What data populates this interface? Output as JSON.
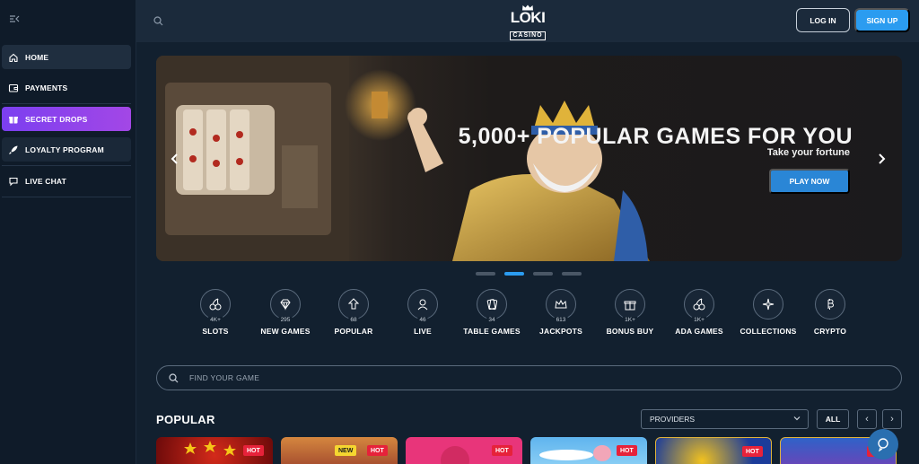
{
  "sidebar": {
    "items": [
      {
        "label": "HOME",
        "icon": "home-icon"
      },
      {
        "label": "PAYMENTS",
        "icon": "wallet-icon"
      },
      {
        "label": "SECRET DROPS",
        "icon": "gift-box-icon"
      },
      {
        "label": "LOYALTY PROGRAM",
        "icon": "rocket-icon"
      },
      {
        "label": "LIVE CHAT",
        "icon": "chat-bubble-icon"
      }
    ]
  },
  "header": {
    "logo_word": "LOKI",
    "logo_sub": "CASINO",
    "login_label": "LOG IN",
    "signup_label": "SIGN UP"
  },
  "hero": {
    "title": "5,000+ POPULAR GAMES FOR YOU",
    "subtitle": "Take your fortune",
    "cta_label": "PLAY NOW",
    "slide_count": 4,
    "active_slide": 2
  },
  "categories": [
    {
      "label": "SLOTS",
      "count": "4K+",
      "icon": "cherries-icon"
    },
    {
      "label": "NEW GAMES",
      "count": "295",
      "icon": "diamond-icon"
    },
    {
      "label": "POPULAR",
      "count": "68",
      "icon": "top-arrow-icon"
    },
    {
      "label": "LIVE",
      "count": "46",
      "icon": "dealer-icon"
    },
    {
      "label": "TABLE GAMES",
      "count": "34",
      "icon": "cards-icon"
    },
    {
      "label": "JACKPOTS",
      "count": "613",
      "icon": "crown-icon"
    },
    {
      "label": "BONUS BUY",
      "count": "1K+",
      "icon": "gift-icon"
    },
    {
      "label": "ADA GAMES",
      "count": "1K+",
      "icon": "cherries-icon"
    },
    {
      "label": "COLLECTIONS",
      "count": "",
      "icon": "sparkles-icon"
    },
    {
      "label": "CRYPTO",
      "count": "",
      "icon": "bitcoin-icon"
    }
  ],
  "search": {
    "placeholder": "FIND YOUR GAME"
  },
  "popular": {
    "title": "POPULAR",
    "providers_label": "PROVIDERS",
    "all_label": "ALL",
    "prev_label": "‹",
    "next_label": "›"
  },
  "games": [
    {
      "badges": [
        "HOT"
      ],
      "color": "#b01818"
    },
    {
      "badges": [
        "NEW",
        "HOT"
      ],
      "color": "#c8703a"
    },
    {
      "badges": [
        "HOT"
      ],
      "color": "#e8357a"
    },
    {
      "badges": [
        "HOT"
      ],
      "color": "#5fb4ee"
    },
    {
      "badges": [
        "HOT"
      ],
      "color": "#1b3c9a"
    },
    {
      "badges": [
        "HOT"
      ],
      "color": "#2f62c8"
    }
  ],
  "colors": {
    "accent": "#2b9cf0",
    "secret_drops": "#8a43ec",
    "hot": "#e6223a",
    "new": "#f5d630"
  }
}
